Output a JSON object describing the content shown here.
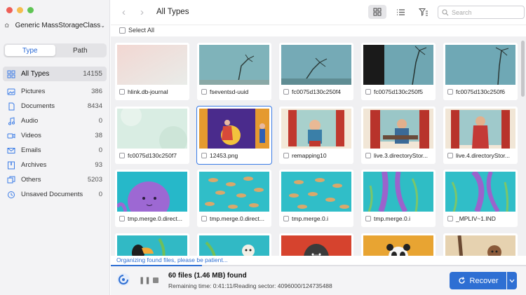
{
  "device": {
    "name": "Generic MassStorageClass"
  },
  "segments": {
    "type": "Type",
    "path": "Path"
  },
  "categories": [
    {
      "label": "All Types",
      "count": "14155"
    },
    {
      "label": "Pictures",
      "count": "386"
    },
    {
      "label": "Documents",
      "count": "8434"
    },
    {
      "label": "Audio",
      "count": "0"
    },
    {
      "label": "Videos",
      "count": "38"
    },
    {
      "label": "Emails",
      "count": "0"
    },
    {
      "label": "Archives",
      "count": "93"
    },
    {
      "label": "Others",
      "count": "5203"
    },
    {
      "label": "Unsaved Documents",
      "count": "0"
    }
  ],
  "header": {
    "title": "All Types"
  },
  "search": {
    "placeholder": "Search"
  },
  "select_all": "Select All",
  "files": [
    "hlink.db-journal",
    "fseventsd-uuid",
    "fc0075d130c250f4",
    "fc0075d130c250f5",
    "fc0075d130c250f6",
    "fc0075d130c250f7",
    "12453.png",
    "remapping10",
    "live.3.directoryStor...",
    "live.4.directoryStor...",
    "tmp.merge.0.direct...",
    "tmp.merge.0.direct...",
    "tmp.merge.0.i",
    "tmp.merge.0.i",
    "_MPLIV~1.IND"
  ],
  "status": {
    "organizing": "Organizing found files, please be patient...",
    "progress": 0.22,
    "found": "60 files (1.46 MB) found",
    "remaining": "Remaining time: 0:41:11/Reading sector: 4096000/124735488"
  },
  "buttons": {
    "recover": "Recover"
  },
  "colors": {
    "accent": "#2e6fd3",
    "close": "#ee5f57",
    "minimize": "#f5bd4f",
    "zoom": "#5fc454"
  }
}
